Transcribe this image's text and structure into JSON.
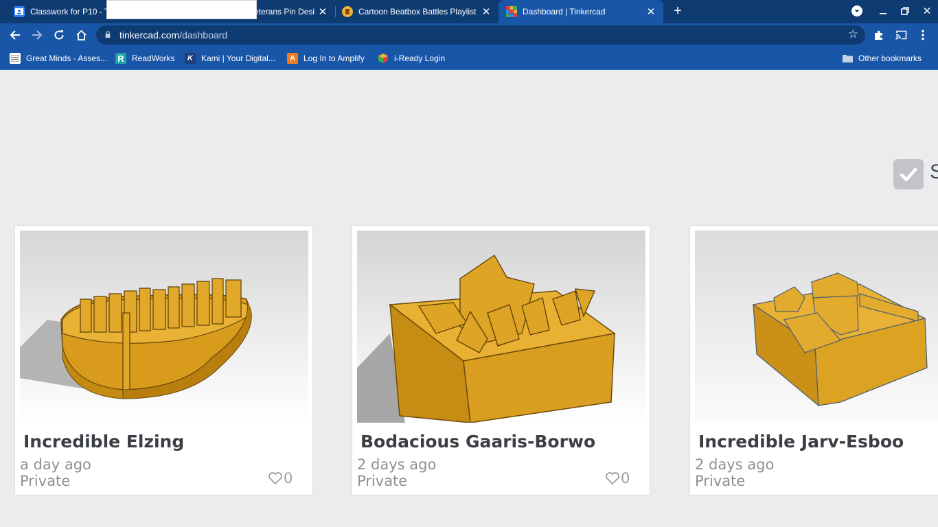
{
  "tabs": [
    {
      "title": "Classwork for P10 - T",
      "favicon": "classroom-icon",
      "active": false
    },
    {
      "title": "eterans Pin Desi",
      "active": false
    },
    {
      "title": "Cartoon Beatbox Battles Playlist",
      "favicon": "beatbox-icon",
      "active": false
    },
    {
      "title": "Dashboard | Tinkercad",
      "favicon": "tinkercad-icon",
      "active": true
    }
  ],
  "address": {
    "host": "tinkercad.com",
    "path": "/dashboard"
  },
  "bookmarks": [
    {
      "label": "Great Minds - Asses...",
      "icon": "greatminds-icon"
    },
    {
      "label": "ReadWorks",
      "icon": "readworks-icon",
      "glyph": "R"
    },
    {
      "label": "Kami | Your Digital...",
      "icon": "kami-icon",
      "glyph": "K"
    },
    {
      "label": "Log In to Amplify",
      "icon": "amplify-icon",
      "glyph": "A"
    },
    {
      "label": "i-Ready Login",
      "icon": "iready-icon"
    }
  ],
  "other_bookmarks": "Other bookmarks",
  "select_peek": "S",
  "designs": [
    {
      "name": "Incredible Elzing",
      "time": "a day ago",
      "visibility": "Private",
      "likes": "0"
    },
    {
      "name": "Bodacious Gaaris-Borwo",
      "time": "2 days ago",
      "visibility": "Private",
      "likes": "0"
    },
    {
      "name": "Incredible Jarv-Esboo",
      "time": "2 days ago",
      "visibility": "Private"
    }
  ],
  "colors": {
    "tab_bar": "#0f3b73",
    "toolbar": "#1a56a8",
    "page_bg": "#ebecee",
    "model_gold": "#e5aa2c"
  }
}
